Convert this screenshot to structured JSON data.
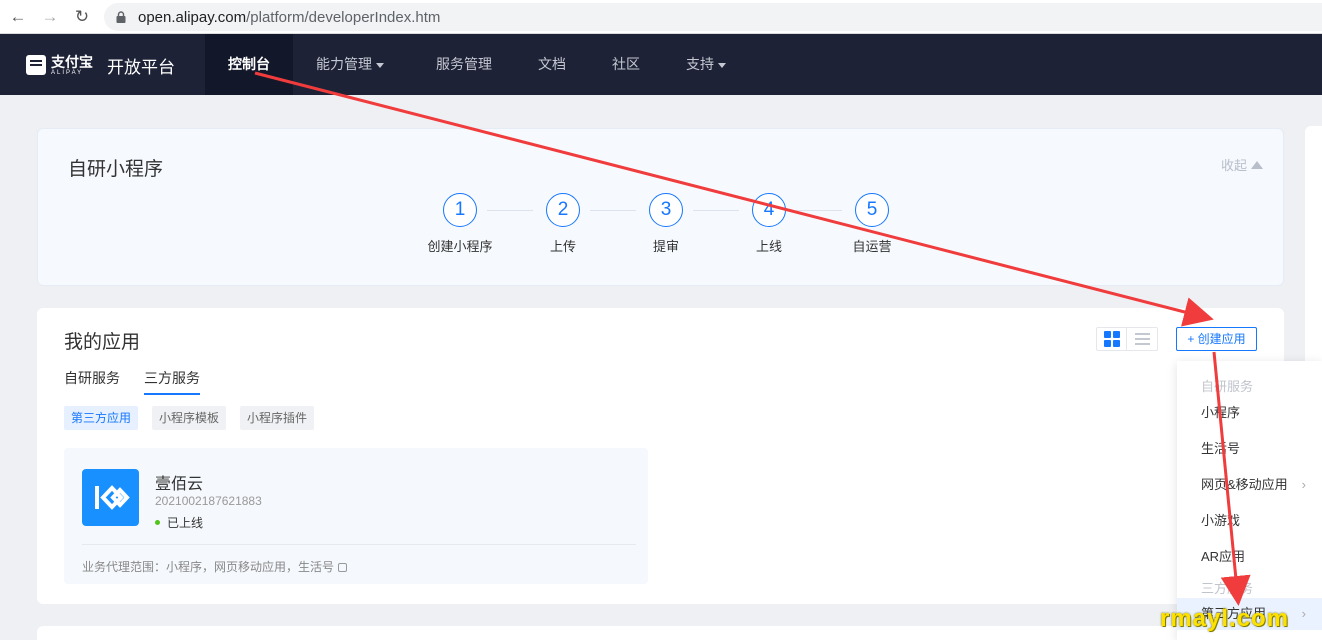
{
  "browser": {
    "url_host": "open.alipay.com",
    "url_path": "/platform/developerIndex.htm"
  },
  "topnav": {
    "logo_cn": "支付宝",
    "logo_en": "ALIPAY",
    "platform_title": "开放平台",
    "items": [
      {
        "label": "控制台",
        "active": true
      },
      {
        "label": "能力管理",
        "dropdown": true
      },
      {
        "label": "服务管理"
      },
      {
        "label": "文档"
      },
      {
        "label": "社区"
      },
      {
        "label": "支持",
        "dropdown": true
      }
    ]
  },
  "steps_card": {
    "title": "自研小程序",
    "collapse_label": "收起",
    "steps": [
      {
        "num": "1",
        "label": "创建小程序"
      },
      {
        "num": "2",
        "label": "上传"
      },
      {
        "num": "3",
        "label": "提审"
      },
      {
        "num": "4",
        "label": "上线"
      },
      {
        "num": "5",
        "label": "自运营"
      }
    ]
  },
  "apps_card": {
    "title": "我的应用",
    "create_label": "+ 创建应用",
    "tabs": [
      {
        "label": "自研服务"
      },
      {
        "label": "三方服务",
        "active": true
      }
    ],
    "chips": [
      {
        "label": "第三方应用",
        "active": true
      },
      {
        "label": "小程序模板"
      },
      {
        "label": "小程序插件"
      }
    ],
    "app": {
      "name": "壹佰云",
      "id": "2021002187621883",
      "status": "已上线",
      "scope": "业务代理范围：小程序，网页移动应用，生活号"
    }
  },
  "dropdown": {
    "group1": "自研服务",
    "items1": [
      "小程序",
      "生活号",
      "网页&移动应用",
      "小游戏",
      "AR应用"
    ],
    "group2": "三方服务",
    "items2": [
      "第三方应用"
    ]
  },
  "colors": {
    "accent": "#1677ff",
    "nav_bg": "#1d2236",
    "arrow": "#f03c3c",
    "status_online": "#52c41a"
  },
  "watermark": "rmayl.com"
}
